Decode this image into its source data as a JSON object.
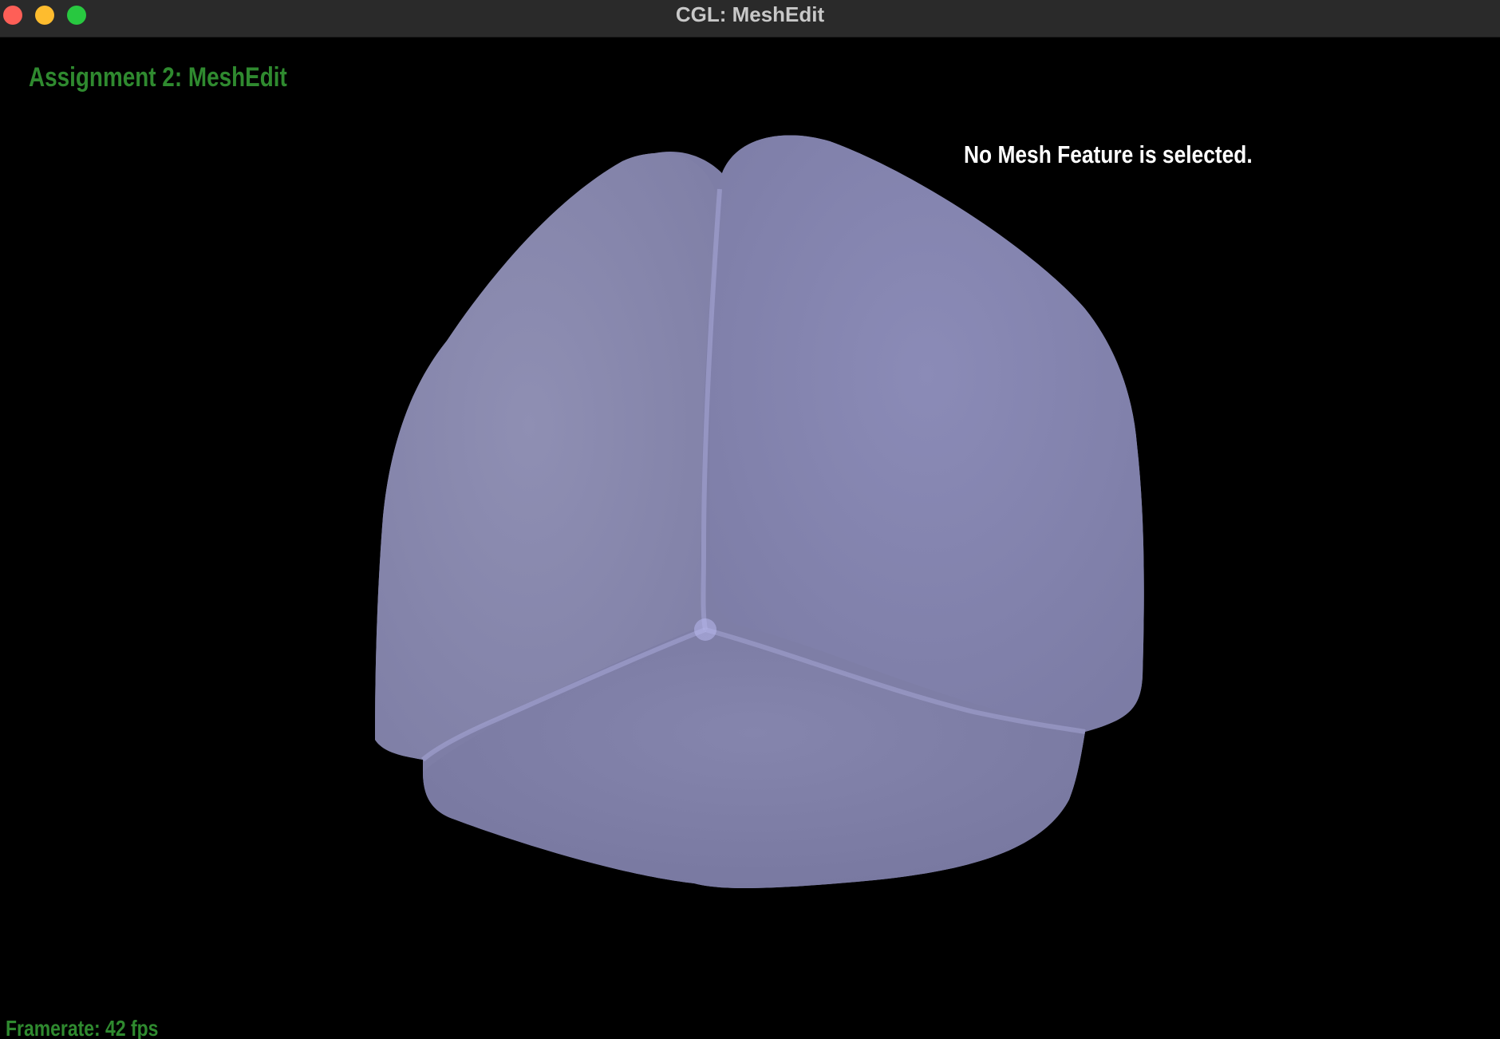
{
  "window": {
    "title": "CGL: MeshEdit"
  },
  "hud": {
    "title": "Assignment 2: MeshEdit",
    "status": "No Mesh Feature is selected.",
    "framerate": "Framerate: 42 fps"
  },
  "icons": {
    "close": "close-button-icon",
    "minimize": "minimize-button-icon",
    "zoom": "zoom-button-icon"
  },
  "colors": {
    "hud_text": "#2f8a2f",
    "status_text": "#ffffff",
    "mesh_surface": "#8a8ab4",
    "background": "#000000"
  }
}
